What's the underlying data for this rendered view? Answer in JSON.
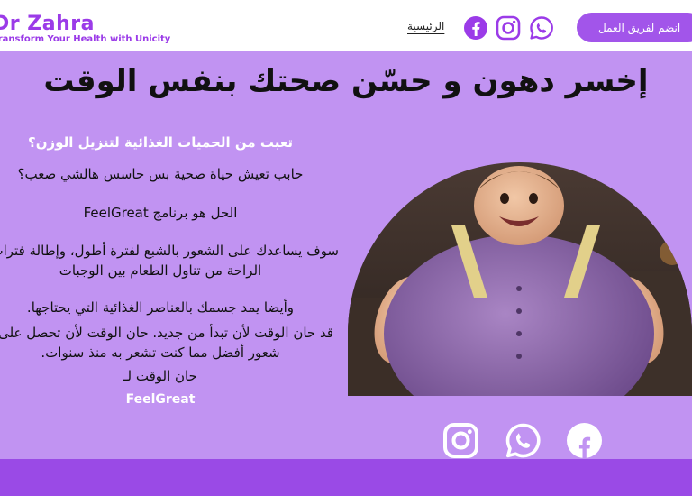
{
  "header": {
    "brand_name": "Dr Zahra",
    "brand_tagline": "Transform Your Health with Unicity",
    "nav_home": "الرئيسية",
    "join_button": "انضم لفريق العمل",
    "social_icons": [
      "facebook-icon",
      "instagram-icon",
      "whatsapp-icon"
    ]
  },
  "main": {
    "title": "إخسر دهون و حسّن صحتك بنفس الوقت",
    "question_1": "تعبت من الحميات الغذائية لتنزيل الوزن؟",
    "question_2": "حابب تعيش حياة صحية بس حاسس هالشي صعب؟",
    "solution": "الحل هو برنامج FeelGreat",
    "para_1_line_1": "سوف يساعدك على الشعور بالشبع لفترة أطول، وإطالة فترات",
    "para_1_line_2": "الراحة من تناول الطعام بين الوجبات",
    "para_2_line_1": "وأيضا يمد جسمك بالعناصر الغذائية التي يحتاجها.",
    "para_2_line_2": "قد حان الوقت لأن تبدأ من جديد. حان الوقت لأن تحصل على",
    "para_2_line_3": "شعور أفضل مما كنت تشعر به منذ سنوات.",
    "closing": "حان الوقت لـ",
    "brand_word": "FeelGreat"
  },
  "colors": {
    "page_bg": "#c193f2",
    "accent": "#9b3be8",
    "button": "#a255ea",
    "footer": "#9a4ae6"
  },
  "bottom_icons": [
    "instagram-icon",
    "whatsapp-icon",
    "facebook-icon"
  ]
}
